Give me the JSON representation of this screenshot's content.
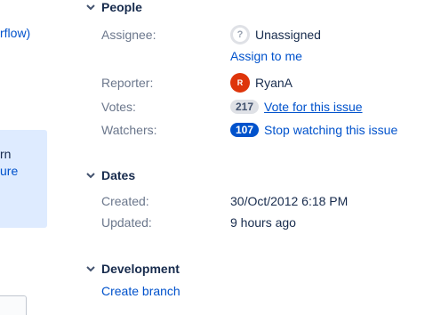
{
  "left_fragment": {
    "link_text": "rflow)",
    "panel_line1": "rn",
    "panel_line2": "ure"
  },
  "people": {
    "title": "People",
    "assignee_label": "Assignee:",
    "assignee_value": "Unassigned",
    "assign_to_me": "Assign to me",
    "reporter_label": "Reporter:",
    "reporter_initial": "R",
    "reporter_value": "RyanA",
    "votes_label": "Votes:",
    "votes_count": "217",
    "votes_link": "Vote for this issue",
    "watchers_label": "Watchers:",
    "watchers_count": "107",
    "watchers_link": "Stop watching this issue"
  },
  "dates": {
    "title": "Dates",
    "created_label": "Created:",
    "created_value": "30/Oct/2012 6:18 PM",
    "updated_label": "Updated:",
    "updated_value": "9 hours ago"
  },
  "development": {
    "title": "Development",
    "create_branch": "Create branch"
  },
  "colors": {
    "link": "#0052cc",
    "label": "#6b778c",
    "text": "#172b4d",
    "reporter_avatar": "#de350b",
    "info_panel": "#deebff"
  }
}
